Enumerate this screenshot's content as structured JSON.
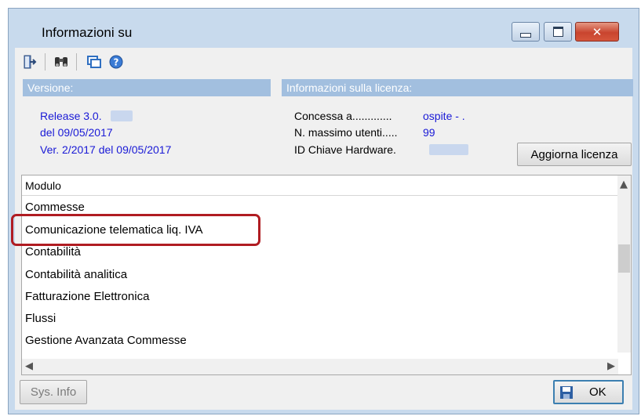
{
  "window": {
    "title": "Informazioni su"
  },
  "toolbar": {
    "icons": [
      "exit-icon",
      "binoculars-icon",
      "windows-icon",
      "help-icon"
    ]
  },
  "version": {
    "header": "Versione:",
    "release": "Release 3.0.",
    "date": "del 09/05/2017",
    "ver": "Ver. 2/2017 del 09/05/2017"
  },
  "license": {
    "header": "Informazioni sulla licenza:",
    "granted_label": "Concessa a.............",
    "granted_value": "ospite - .",
    "max_users_label": "N. massimo utenti.....",
    "max_users_value": "99",
    "hw_key_label": "ID Chiave Hardware.",
    "update_button": "Aggiorna licenza"
  },
  "modules": {
    "column_header": "Modulo",
    "items": [
      "Commesse",
      "Comunicazione telematica liq. IVA",
      "Contabilità",
      "Contabilità analitica",
      "Fatturazione Elettronica",
      "Flussi",
      "Gestione Avanzata Commesse"
    ]
  },
  "footer": {
    "sysinfo_button": "Sys. Info",
    "ok_button": "OK"
  },
  "colors": {
    "highlight": "#b01c22",
    "link": "#1a1ad6",
    "header_bg": "#a2bfdf"
  }
}
